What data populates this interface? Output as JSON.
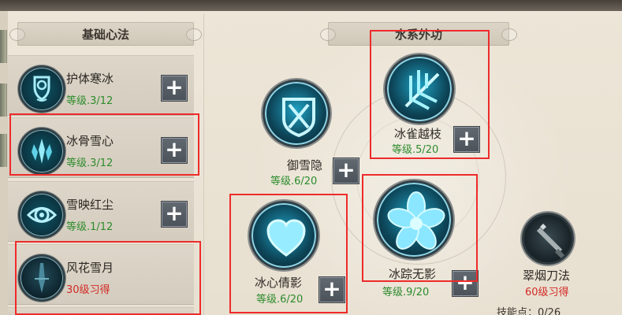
{
  "sections": {
    "basic": {
      "title": "基础心法"
    },
    "water": {
      "title": "水系外功"
    }
  },
  "left_skills": [
    {
      "name": "护体寒冰",
      "sub": "等级.3/12",
      "icon": "shield-gem-icon",
      "button": "+"
    },
    {
      "name": "冰骨雪心",
      "sub": "等级.3/12",
      "icon": "ice-crystal-icon",
      "button": "+"
    },
    {
      "name": "雪映红尘",
      "sub": "等级.1/12",
      "icon": "eye-icon",
      "button": "+"
    },
    {
      "name": "风花雪月",
      "sub": "30级习得",
      "icon": "sword-shadow-icon",
      "button": ""
    }
  ],
  "right_skills": [
    {
      "name": "御雪隐",
      "sub": "等级.6/20",
      "icon": "crossed-blades-shield-icon",
      "button": "+"
    },
    {
      "name": "冰雀越枝",
      "sub": "等级.5/20",
      "icon": "ice-wing-icon",
      "button": "+"
    },
    {
      "name": "冰心倩影",
      "sub": "等级.6/20",
      "icon": "heart-icon",
      "button": "+"
    },
    {
      "name": "冰踪无影",
      "sub": "等级.9/20",
      "icon": "ice-flower-icon",
      "button": "+"
    },
    {
      "name": "翠烟刀法",
      "sub": "60级习得",
      "icon": "blade-icon",
      "button": ""
    }
  ],
  "footer": {
    "skill_points": "技能点：0/26"
  },
  "colors": {
    "level_green": "#2c8b2d",
    "locked_red": "#d32b28",
    "highlight_red": "#ee2b2b"
  }
}
